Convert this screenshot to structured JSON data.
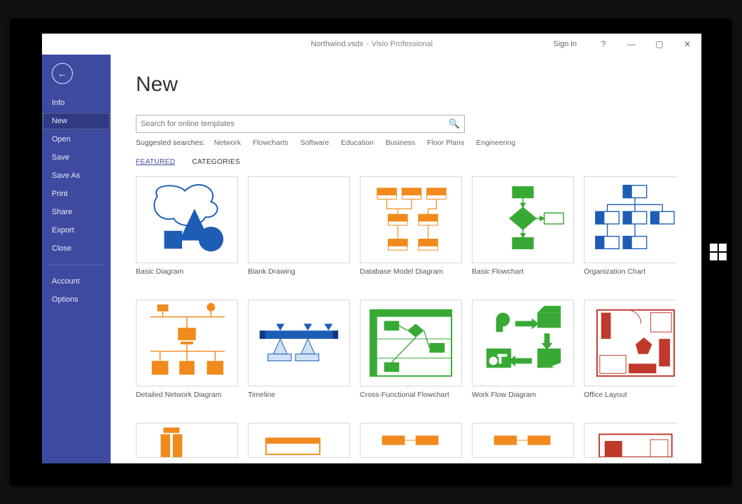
{
  "titlebar": {
    "file": "Northwind.vsdx",
    "app": "Visio Professional",
    "signin": "Sign in",
    "help": "?",
    "minimize": "—",
    "maximize": "▢",
    "close": "✕"
  },
  "sidebar": {
    "back": "←",
    "nav": [
      "Info",
      "New",
      "Open",
      "Save",
      "Save As",
      "Print",
      "Share",
      "Export",
      "Close"
    ],
    "nav2": [
      "Account",
      "Options"
    ],
    "selected": "New"
  },
  "main": {
    "pageTitle": "New",
    "search": {
      "placeholder": "Search for online templates"
    },
    "suggestLabel": "Suggested searches:",
    "suggestTerms": [
      "Network",
      "Flowcharts",
      "Software",
      "Education",
      "Business",
      "Floor Plans",
      "Engineering"
    ],
    "tabs": {
      "featured": "FEATURED",
      "categories": "CATEGORIES"
    },
    "templates": [
      {
        "label": "Basic Diagram",
        "svg": "basic-diagram"
      },
      {
        "label": "Blank Drawing",
        "svg": "blank"
      },
      {
        "label": "Database Model Diagram",
        "svg": "database"
      },
      {
        "label": "Basic Flowchart",
        "svg": "flowchart"
      },
      {
        "label": "Organization Chart",
        "svg": "orgchart"
      },
      {
        "label": "Detailed Network Diagram",
        "svg": "network"
      },
      {
        "label": "Timeline",
        "svg": "timeline"
      },
      {
        "label": "Cross-Functional Flowchart",
        "svg": "crossfunc"
      },
      {
        "label": "Work Flow Diagram",
        "svg": "workflow"
      },
      {
        "label": "Office Layout",
        "svg": "office"
      }
    ],
    "partialRow": [
      "orange-partial",
      "orange-partial",
      "orange-partial",
      "orange-partial",
      "red-partial"
    ]
  }
}
